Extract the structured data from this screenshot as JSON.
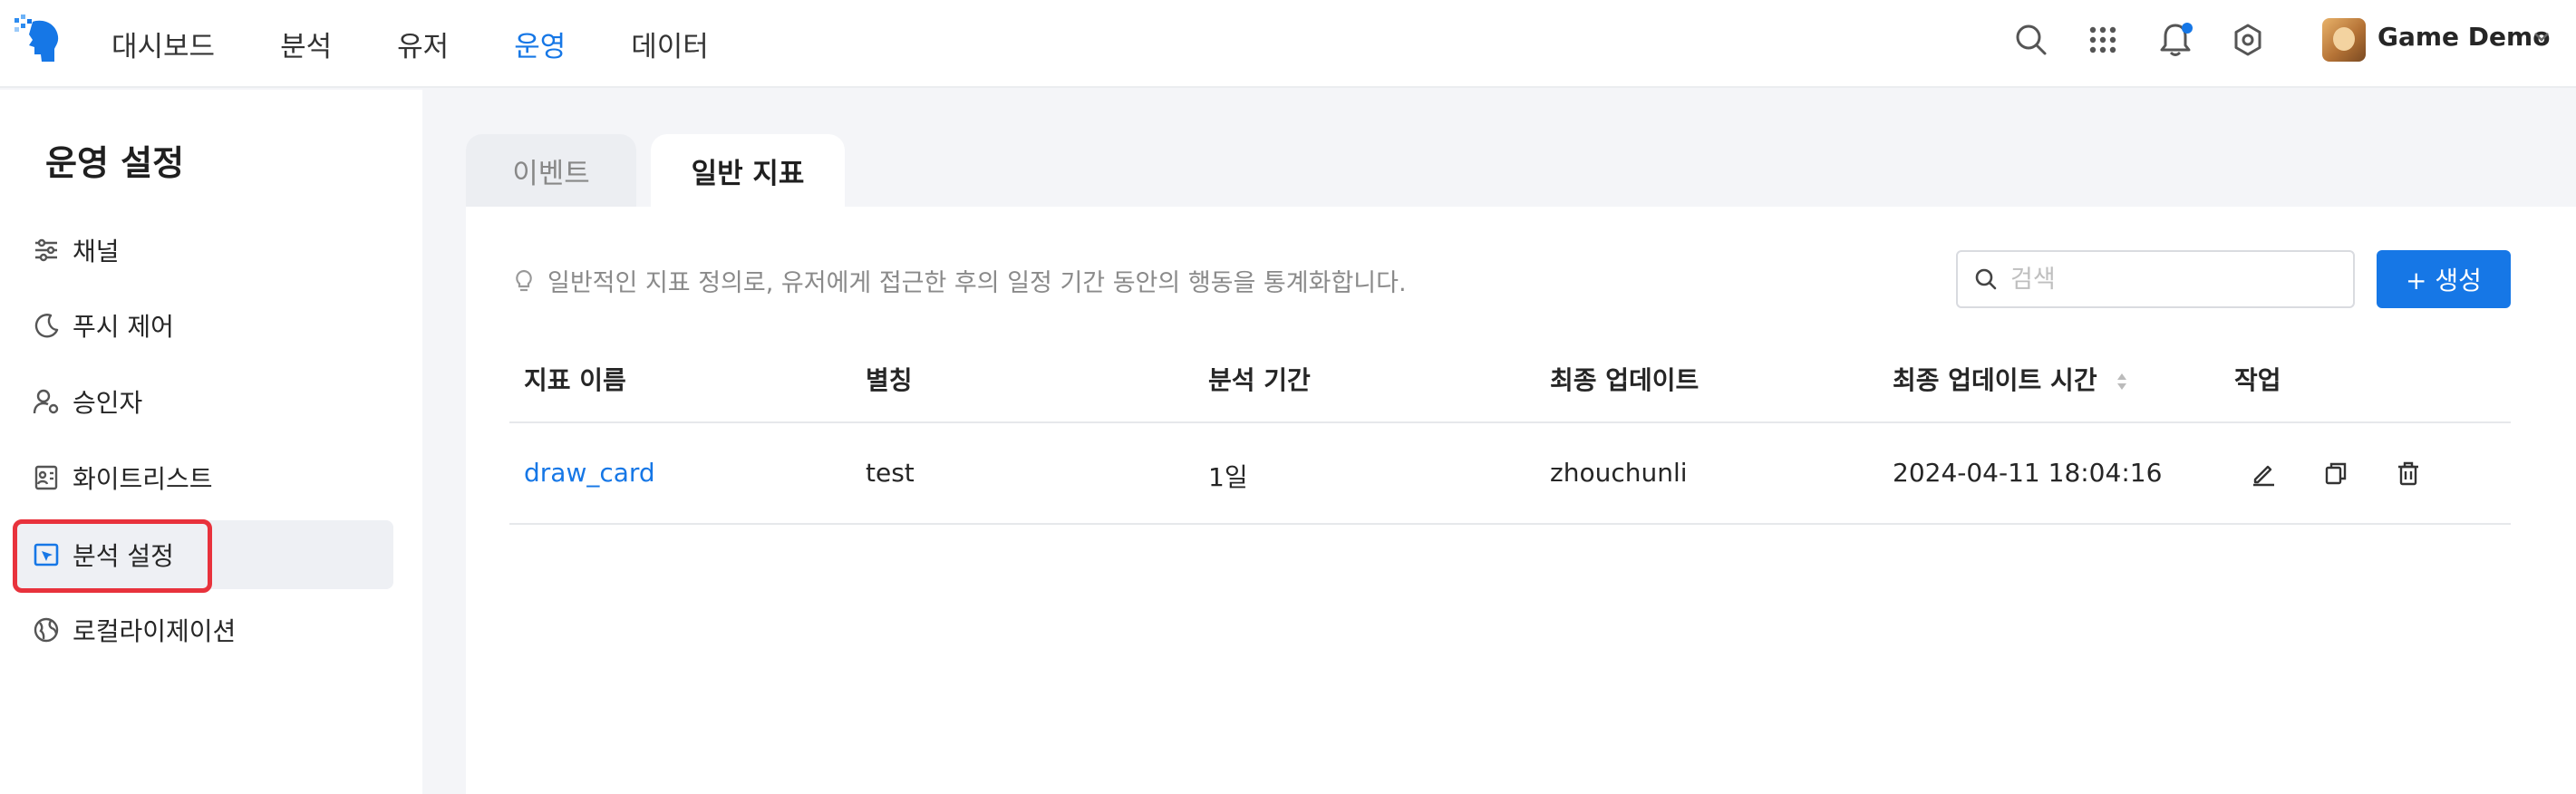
{
  "top_nav": {
    "items": [
      {
        "label": "대시보드",
        "active": false
      },
      {
        "label": "분석",
        "active": false
      },
      {
        "label": "유저",
        "active": false
      },
      {
        "label": "운영",
        "active": true
      },
      {
        "label": "데이터",
        "active": false
      }
    ],
    "icons": [
      "search-icon",
      "apps-grid-icon",
      "bell-icon",
      "gear-icon"
    ],
    "notification_dot": true,
    "user_name": "Game Demo",
    "accent_color": "#1677e6"
  },
  "sidebar": {
    "title": "운영 설정",
    "items": [
      {
        "label": "채널",
        "icon": "sliders-icon",
        "active": false
      },
      {
        "label": "푸시 제어",
        "icon": "moon-icon",
        "active": false
      },
      {
        "label": "승인자",
        "icon": "user-settings-icon",
        "active": false
      },
      {
        "label": "화이트리스트",
        "icon": "id-card-icon",
        "active": false
      },
      {
        "label": "분석 설정",
        "icon": "cursor-box-icon",
        "active": true
      },
      {
        "label": "로컬라이제이션",
        "icon": "globe-icon",
        "active": false
      }
    ],
    "highlight_color": "#e8323c"
  },
  "tabs": [
    {
      "label": "이벤트",
      "active": false
    },
    {
      "label": "일반 지표",
      "active": true
    }
  ],
  "main": {
    "hint": "일반적인 지표 정의로, 유저에게 접근한 후의 일정 기간 동안의 행동을 통계화합니다.",
    "search_placeholder": "검색",
    "create_label": "+ 생성"
  },
  "table": {
    "columns": [
      "지표 이름",
      "별칭",
      "분석 기간",
      "최종 업데이트",
      "최종 업데이트 시간",
      "작업"
    ],
    "rows": [
      {
        "name": "draw_card",
        "alias": "test",
        "period": "1일",
        "updated_by": "zhouchunli",
        "updated_at": "2024-04-11 18:04:16",
        "actions": [
          "edit-icon",
          "copy-icon",
          "trash-icon"
        ]
      }
    ]
  }
}
